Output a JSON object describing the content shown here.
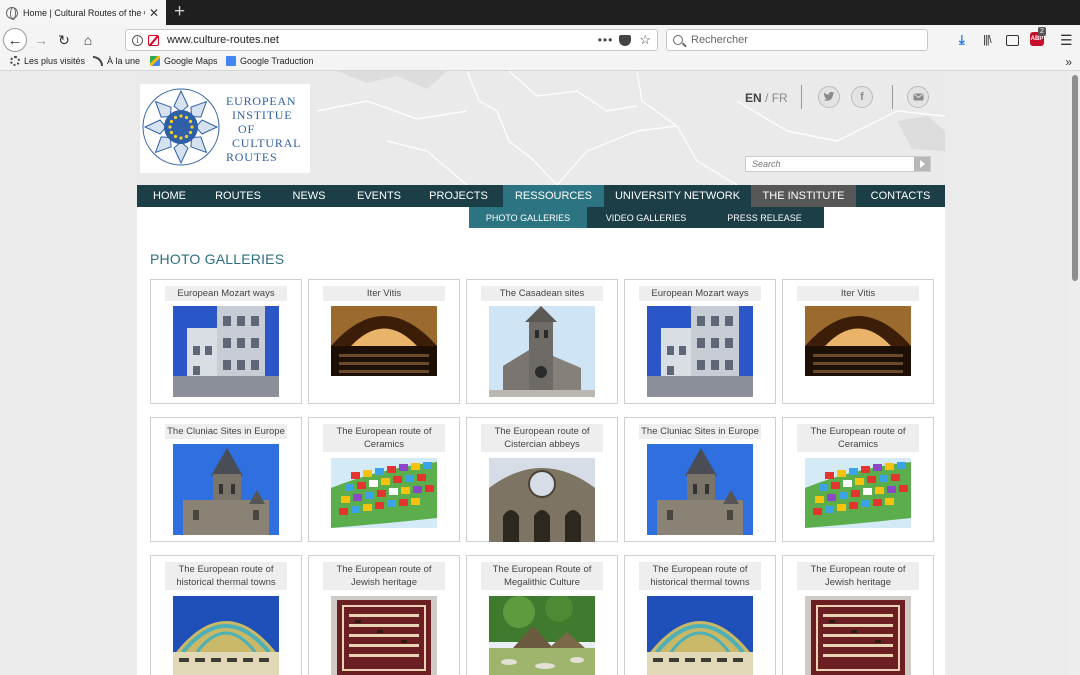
{
  "browser": {
    "tab_title": "Home | Cultural Routes of the Council of Europe",
    "new_tab": "+",
    "url": "www.culture-routes.net",
    "search_placeholder": "Rechercher",
    "abp_badge": "2",
    "bookmarks": [
      "Les plus visités",
      "À la une",
      "Google Maps",
      "Google Traduction"
    ]
  },
  "header": {
    "logo_lines": [
      "EUROPEAN",
      "INSTITUE",
      "OF",
      "CULTURAL",
      "ROUTES"
    ],
    "lang_active": "EN",
    "lang_sep": " / ",
    "lang_other": "FR",
    "search_placeholder": "Search",
    "social_icons": [
      "twitter-icon",
      "facebook-icon",
      "mail-icon"
    ]
  },
  "nav": {
    "items": [
      "HOME",
      "ROUTES",
      "NEWS",
      "EVENTS",
      "PROJECTS",
      "RESSOURCES",
      "UNIVERSITY NETWORK",
      "THE INSTITUTE",
      "CONTACTS"
    ],
    "active": "RESSOURCES",
    "sub_items": [
      "PHOTO GALLERIES",
      "VIDEO GALLERIES",
      "PRESS RELEASE"
    ],
    "sub_active": "PHOTO GALLERIES"
  },
  "page": {
    "title": "PHOTO GALLERIES",
    "galleries": [
      [
        "European Mozart ways",
        "Iter Vitis",
        "The Casadean sites",
        "European Mozart ways",
        "Iter Vitis"
      ],
      [
        "The Cluniac Sites in Europe",
        "The European route of Ceramics",
        "The European route of Cistercian abbeys",
        "The Cluniac Sites in Europe",
        "The European route of Ceramics"
      ],
      [
        "The European route of historical thermal towns",
        "The European route of Jewish heritage",
        "The European Route of Megalithic Culture",
        "The European route of historical thermal towns",
        "The European route of Jewish heritage"
      ]
    ]
  },
  "colors": {
    "nav_bg": "#1b3e47",
    "nav_active": "#2c7481",
    "title": "#2b6f7f",
    "logo_blue": "#2f5fa7"
  }
}
